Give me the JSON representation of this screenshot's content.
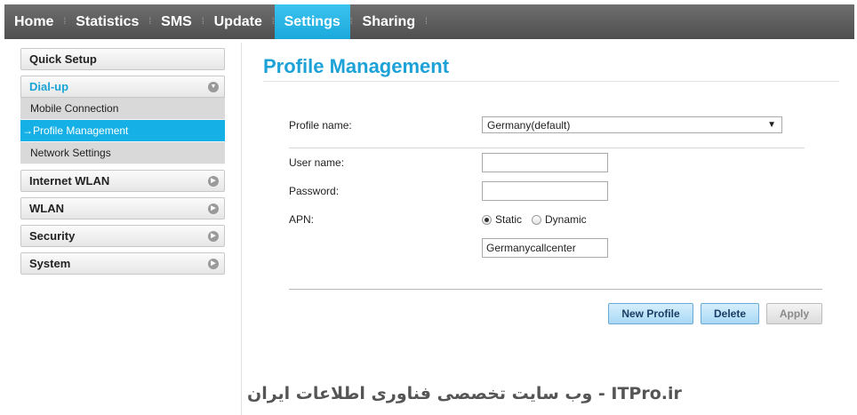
{
  "nav": {
    "tabs": [
      {
        "label": "Home"
      },
      {
        "label": "Statistics"
      },
      {
        "label": "SMS"
      },
      {
        "label": "Update"
      },
      {
        "label": "Settings",
        "active": true
      },
      {
        "label": "Sharing"
      }
    ]
  },
  "sidebar": {
    "quick_setup": "Quick Setup",
    "dialup": "Dial-up",
    "dialup_items": [
      "Mobile Connection",
      "→Profile Management",
      "Network Settings"
    ],
    "internet_wlan": "Internet WLAN",
    "wlan": "WLAN",
    "security": "Security",
    "system": "System"
  },
  "main": {
    "title": "Profile Management",
    "profile_name_label": "Profile name:",
    "profile_selected": "Germany(default)",
    "user_name_label": "User name:",
    "user_name_value": "",
    "password_label": "Password:",
    "password_value": "",
    "apn_label": "APN:",
    "apn_static": "Static",
    "apn_dynamic": "Dynamic",
    "apn_mode": "Static",
    "apn_value": "Germanycallcenter",
    "buttons": {
      "new_profile": "New Profile",
      "delete": "Delete",
      "apply": "Apply"
    }
  },
  "watermark": "ITPro.ir - وب سایت تخصصی فناوری اطلاعات ایران",
  "colors": {
    "accent": "#1da2d8",
    "nav_bg": "#5a5a5a",
    "active_tab": "#1aa9dc"
  }
}
